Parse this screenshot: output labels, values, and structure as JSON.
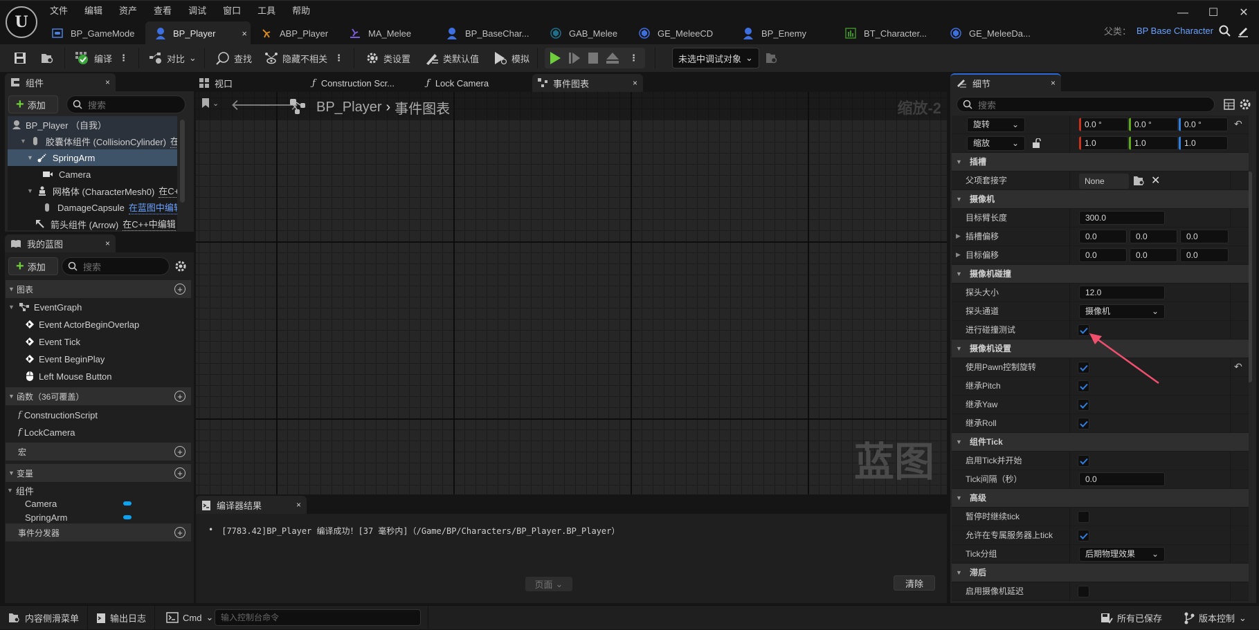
{
  "window": {
    "menu": [
      "文件",
      "编辑",
      "资产",
      "查看",
      "调试",
      "窗口",
      "工具",
      "帮助"
    ],
    "controls": {
      "minimize": "—",
      "maximize": "☐",
      "close": "✕"
    }
  },
  "doc_tabs": [
    {
      "label": "BP_GameMode",
      "icon": "gamemode-icon",
      "active": false
    },
    {
      "label": "BP_Player",
      "icon": "character-icon",
      "active": true,
      "close": "×"
    },
    {
      "label": "ABP_Player",
      "icon": "anim-blueprint-icon",
      "active": false
    },
    {
      "label": "MA_Melee",
      "icon": "montage-icon",
      "active": false
    },
    {
      "label": "BP_BaseChar...",
      "icon": "character-icon",
      "active": false
    },
    {
      "label": "GAB_Melee",
      "icon": "ability-icon",
      "active": false
    },
    {
      "label": "GE_MeleeCD",
      "icon": "effect-icon",
      "active": false
    },
    {
      "label": "BP_Enemy",
      "icon": "character-icon",
      "active": false
    },
    {
      "label": "BT_Character...",
      "icon": "behavior-tree-icon",
      "active": false
    },
    {
      "label": "GE_MeleeDa...",
      "icon": "effect-icon",
      "active": false
    }
  ],
  "parent_class": {
    "label": "父类：",
    "value": "BP Base Character"
  },
  "toolbar": {
    "compile": "编译",
    "diff": "对比",
    "find": "查找",
    "hide_unrelated": "隐藏不相关",
    "class_settings": "类设置",
    "class_defaults": "类默认值",
    "simulate": "模拟",
    "debug_target": "未选中调试对象"
  },
  "components_panel": {
    "title": "组件",
    "close": "×",
    "add": "添加",
    "search_placeholder": "搜索",
    "tree": [
      {
        "label": "BP_Player （自我）",
        "icon": "actor-icon",
        "indent": 0
      },
      {
        "label": "胶囊体组件 (CollisionCylinder)",
        "link": "在",
        "icon": "capsule-icon",
        "indent": 1,
        "expanded": true
      },
      {
        "label": "SpringArm",
        "icon": "spring-arm-icon",
        "indent": 1,
        "expanded": true,
        "selected": true
      },
      {
        "label": "Camera",
        "icon": "camera-icon",
        "indent": 2
      },
      {
        "label": "网格体 (CharacterMesh0)",
        "link": "在C+",
        "icon": "skeletal-mesh-icon",
        "indent": 1,
        "expanded": true
      },
      {
        "label": "DamageCapsule",
        "link": "在蓝图中编辑",
        "link_blue": true,
        "icon": "capsule-icon",
        "indent": 2
      },
      {
        "label": "箭头组件 (Arrow)",
        "link": "在C++中编辑",
        "icon": "arrow-icon",
        "indent": 1
      }
    ]
  },
  "my_blueprint": {
    "title": "我的蓝图",
    "close": "×",
    "add": "添加",
    "search_placeholder": "搜索",
    "graphs_header": "图表",
    "event_graph": "EventGraph",
    "events": [
      "Event ActorBeginOverlap",
      "Event Tick",
      "Event BeginPlay",
      "Left Mouse Button"
    ],
    "functions_header": "函数（36可覆盖）",
    "functions": [
      "ConstructionScript",
      "LockCamera"
    ],
    "macros_header": "宏",
    "variables_header": "变量",
    "components_group": "组件",
    "variables": [
      "Camera",
      "SpringArm"
    ],
    "dispatchers_header": "事件分发器"
  },
  "editor_tabs": [
    {
      "label": "视口",
      "icon": "viewport-icon"
    },
    {
      "label": "Construction Scr...",
      "icon": "function-icon"
    },
    {
      "label": "Lock Camera",
      "icon": "function-icon"
    },
    {
      "label": "事件图表",
      "icon": "event-graph-icon",
      "active": true,
      "close": "×"
    }
  ],
  "graph": {
    "breadcrumb_root": "BP_Player",
    "breadcrumb_sep": "›",
    "breadcrumb_leaf": "事件图表",
    "zoom": "缩放-2",
    "watermark": "蓝图"
  },
  "compiler": {
    "title": "编译器结果",
    "close": "×",
    "message": "[7783.42]BP_Player 编译成功！[37 毫秒内]（/Game/BP/Characters/BP_Player.BP_Player）",
    "page_btn": "页面",
    "clear_btn": "清除"
  },
  "details": {
    "title": "细节",
    "close": "×",
    "search_placeholder": "搜索",
    "rotation": {
      "mode": "旋转",
      "x": "0.0 °",
      "y": "0.0 °",
      "z": "0.0 °"
    },
    "scale": {
      "mode": "缩放",
      "x": "1.0",
      "y": "1.0",
      "z": "1.0"
    },
    "sockets_header": "插槽",
    "parent_socket_label": "父项套接字",
    "parent_socket_value": "None",
    "camera_header": "摄像机",
    "target_arm_length_label": "目标臂长度",
    "target_arm_length": "300.0",
    "socket_offset_label": "插槽偏移",
    "socket_offset": [
      "0.0",
      "0.0",
      "0.0"
    ],
    "target_offset_label": "目标偏移",
    "target_offset": [
      "0.0",
      "0.0",
      "0.0"
    ],
    "collision_header": "摄像机碰撞",
    "probe_size_label": "探头大小",
    "probe_size": "12.0",
    "probe_channel_label": "探头通道",
    "probe_channel": "摄像机",
    "do_collision_test_label": "进行碰撞测试",
    "do_collision_test": true,
    "camera_settings_header": "摄像机设置",
    "use_pawn_control_rotation_label": "使用Pawn控制旋转",
    "use_pawn_control_rotation": true,
    "inherit_pitch_label": "继承Pitch",
    "inherit_pitch": true,
    "inherit_yaw_label": "继承Yaw",
    "inherit_yaw": true,
    "inherit_roll_label": "继承Roll",
    "inherit_roll": true,
    "component_tick_header": "组件Tick",
    "start_with_tick_label": "启用Tick并开始",
    "start_with_tick": true,
    "tick_interval_label": "Tick间隔（秒）",
    "tick_interval": "0.0",
    "advanced_header": "高级",
    "tick_when_paused_label": "暂停时继续tick",
    "tick_when_paused": false,
    "allow_dedicated_server_label": "允许在专属服务器上tick",
    "allow_dedicated_server": true,
    "tick_group_label": "Tick分组",
    "tick_group": "后期物理效果",
    "lag_header": "滞后",
    "enable_camera_lag_label": "启用摄像机延迟",
    "enable_camera_lag": false
  },
  "statusbar": {
    "content_drawer": "内容侧滑菜单",
    "output_log": "输出日志",
    "cmd": "Cmd",
    "console_placeholder": "输入控制台命令",
    "all_saved": "所有已保存",
    "source_control": "版本控制"
  },
  "colors": {
    "accent": "#6aa1ff",
    "play": "#6fcf3b",
    "annotation_arrow": "#f0506e",
    "check": "#2f7fe0"
  }
}
